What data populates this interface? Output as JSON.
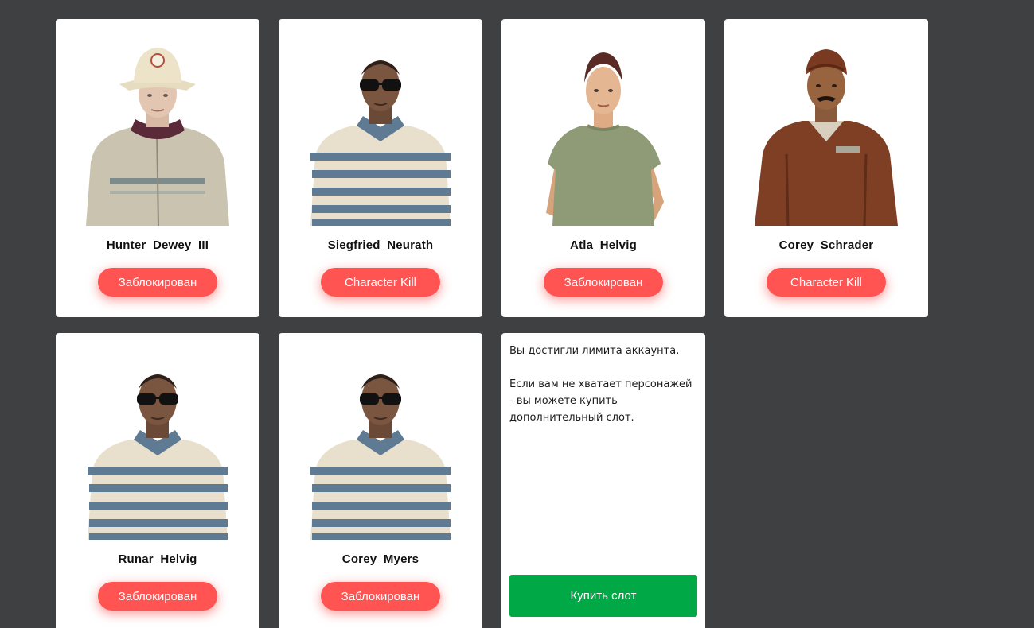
{
  "characters": [
    {
      "name": "Hunter_Dewey_III",
      "status": "Заблокирован",
      "portrait": "bucket-hat-jacket-character"
    },
    {
      "name": "Siegfried_Neurath",
      "status": "Character Kill",
      "portrait": "sunglasses-striped-shirt-character"
    },
    {
      "name": "Atla_Helvig",
      "status": "Заблокирован",
      "portrait": "woman-green-top-character"
    },
    {
      "name": "Corey_Schrader",
      "status": "Character Kill",
      "portrait": "brown-overalls-cap-character"
    },
    {
      "name": "Runar_Helvig",
      "status": "Заблокирован",
      "portrait": "sunglasses-striped-shirt-character"
    },
    {
      "name": "Corey_Myers",
      "status": "Заблокирован",
      "portrait": "sunglasses-striped-shirt-character"
    }
  ],
  "limit_notice": {
    "line1": "Вы достигли лимита аккаунта.",
    "line2": "Если вам не хватает персонажей - вы можете купить дополнительный слот.",
    "buy_label": "Купить слот"
  },
  "colors": {
    "background": "#3f4042",
    "status_button": "#ff5452",
    "buy_button": "#00a846"
  }
}
